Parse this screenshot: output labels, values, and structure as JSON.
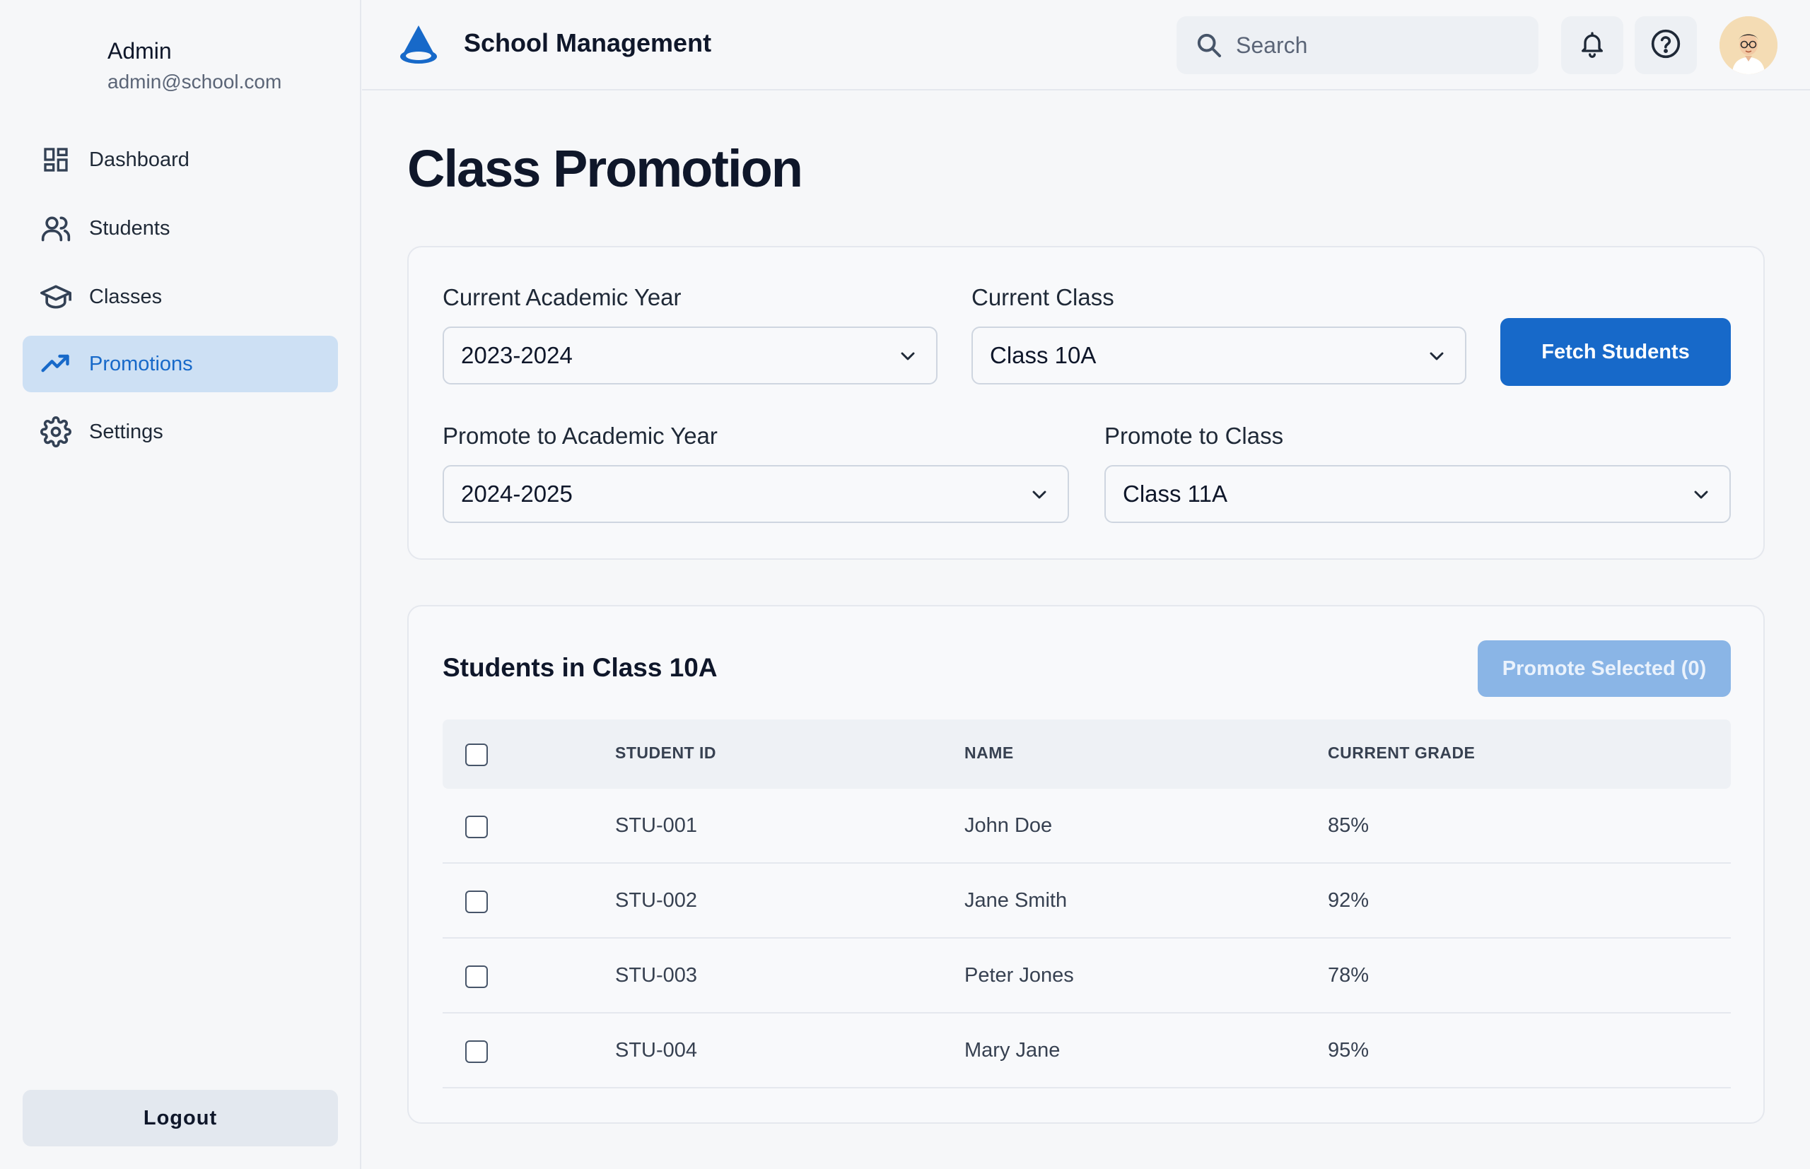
{
  "user": {
    "name": "Admin",
    "email": "admin@school.com"
  },
  "nav": {
    "items": [
      {
        "label": "Dashboard",
        "icon": "dashboard-icon"
      },
      {
        "label": "Students",
        "icon": "users-icon"
      },
      {
        "label": "Classes",
        "icon": "graduation-cap-icon"
      },
      {
        "label": "Promotions",
        "icon": "trending-up-icon",
        "active": true
      },
      {
        "label": "Settings",
        "icon": "gear-icon"
      }
    ],
    "logout_label": "Logout"
  },
  "header": {
    "brand": "School Management",
    "search_placeholder": "Search"
  },
  "page": {
    "title": "Class Promotion"
  },
  "filters": {
    "current_year_label": "Current Academic Year",
    "current_year_value": "2023-2024",
    "current_class_label": "Current Class",
    "current_class_value": "Class 10A",
    "fetch_label": "Fetch Students",
    "promote_year_label": "Promote to Academic Year",
    "promote_year_value": "2024-2025",
    "promote_class_label": "Promote to Class",
    "promote_class_value": "Class 11A"
  },
  "table": {
    "title": "Students in Class 10A",
    "promote_button": "Promote Selected (0)",
    "columns": [
      "STUDENT ID",
      "NAME",
      "CURRENT GRADE"
    ],
    "rows": [
      {
        "id": "STU-001",
        "name": "John Doe",
        "grade": "85%"
      },
      {
        "id": "STU-002",
        "name": "Jane Smith",
        "grade": "92%"
      },
      {
        "id": "STU-003",
        "name": "Peter Jones",
        "grade": "78%"
      },
      {
        "id": "STU-004",
        "name": "Mary Jane",
        "grade": "95%"
      }
    ]
  },
  "colors": {
    "accent": "#1769c9",
    "active_nav_bg": "#cde0f4",
    "disabled_button": "#8ab5e6"
  }
}
